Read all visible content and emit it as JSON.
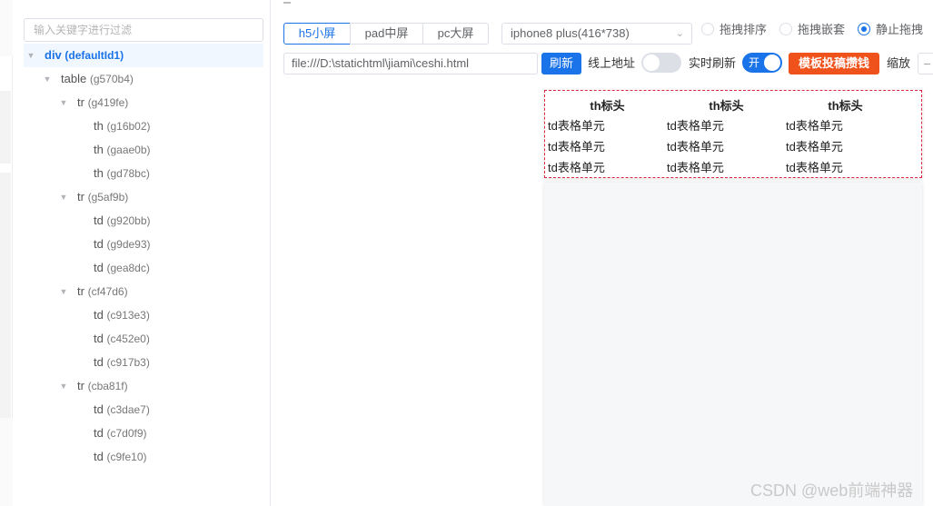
{
  "tree": {
    "filter_placeholder": "输入关键字进行过滤",
    "nodes": [
      {
        "tag": "div",
        "id": "(defaultId1)"
      },
      {
        "tag": "table",
        "id": "(g570b4)"
      },
      {
        "tag": "tr",
        "id": "(g419fe)"
      },
      {
        "tag": "th",
        "id": "(g16b02)"
      },
      {
        "tag": "th",
        "id": "(gaae0b)"
      },
      {
        "tag": "th",
        "id": "(gd78bc)"
      },
      {
        "tag": "tr",
        "id": "(g5af9b)"
      },
      {
        "tag": "td",
        "id": "(g920bb)"
      },
      {
        "tag": "td",
        "id": "(g9de93)"
      },
      {
        "tag": "td",
        "id": "(gea8dc)"
      },
      {
        "tag": "tr",
        "id": "(cf47d6)"
      },
      {
        "tag": "td",
        "id": "(c913e3)"
      },
      {
        "tag": "td",
        "id": "(c452e0)"
      },
      {
        "tag": "td",
        "id": "(c917b3)"
      },
      {
        "tag": "tr",
        "id": "(cba81f)"
      },
      {
        "tag": "td",
        "id": "(c3dae7)"
      },
      {
        "tag": "td",
        "id": "(c7d0f9)"
      },
      {
        "tag": "td",
        "id": "(c9fe10)"
      }
    ]
  },
  "toolbar": {
    "screens": [
      "h5小屏",
      "pad中屏",
      "pc大屏"
    ],
    "active_screen": "h5小屏",
    "device": "iphone8 plus(416*738)",
    "drag_modes": [
      "拖拽排序",
      "拖拽嵌套",
      "静止拖拽"
    ],
    "active_drag_mode": "静止拖拽",
    "url": "file:///D:\\statichtml\\jiami\\ceshi.html",
    "refresh_label": "刷新",
    "online_label": "线上地址",
    "online_on": false,
    "live_refresh_label": "实时刷新",
    "live_refresh_on": true,
    "switch_on_text": "开",
    "template_label": "模板投稿攒钱",
    "zoom_label": "缩放"
  },
  "preview": {
    "headers": [
      "th标头",
      "th标头",
      "th标头"
    ],
    "rows": [
      [
        "td表格单元",
        "td表格单元",
        "td表格单元"
      ],
      [
        "td表格单元",
        "td表格单元",
        "td表格单元"
      ],
      [
        "td表格单元",
        "td表格单元",
        "td表格单元"
      ]
    ]
  },
  "watermark": "CSDN @web前端神器",
  "colors": {
    "accent": "#1a73e8",
    "danger": "#f0521b",
    "selection_border": "#d7263d"
  }
}
